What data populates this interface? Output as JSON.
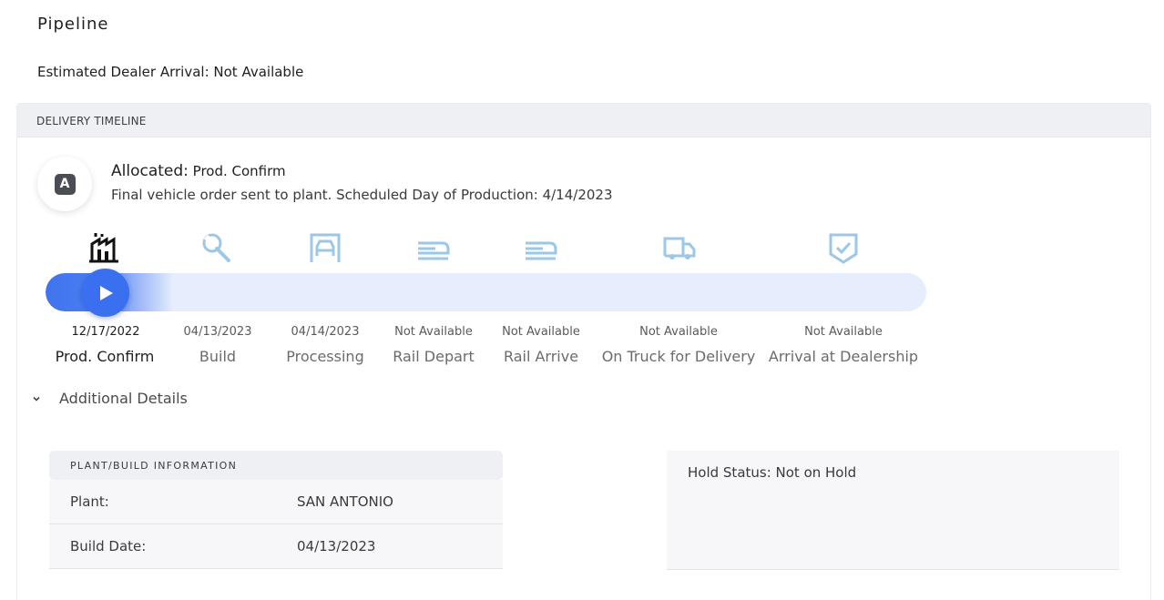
{
  "page": {
    "title": "Pipeline",
    "eta_label": "Estimated Dealer Arrival: Not Available"
  },
  "timeline": {
    "header": "DELIVERY TIMELINE",
    "status_badge": "A",
    "status_label": "Allocated:",
    "status_stage": "Prod. Confirm",
    "status_description": "Final vehicle order sent to plant. Scheduled Day of Production: 4/14/2023",
    "progress_fraction": 0.07,
    "stages": [
      {
        "name": "Prod. Confirm",
        "date": "12/17/2022",
        "icon": "factory-icon",
        "active": true
      },
      {
        "name": "Build",
        "date": "04/13/2023",
        "icon": "wrench-icon",
        "active": false
      },
      {
        "name": "Processing",
        "date": "04/14/2023",
        "icon": "car-garage-icon",
        "active": false
      },
      {
        "name": "Rail Depart",
        "date": "Not Available",
        "icon": "train-icon",
        "active": false
      },
      {
        "name": "Rail Arrive",
        "date": "Not Available",
        "icon": "train-icon",
        "active": false
      },
      {
        "name": "On Truck for Delivery",
        "date": "Not Available",
        "icon": "truck-icon",
        "active": false
      },
      {
        "name": "Arrival at Dealership",
        "date": "Not Available",
        "icon": "shield-check-icon",
        "active": false
      }
    ]
  },
  "details": {
    "toggle_label": "Additional Details",
    "plant_header": "PLANT/BUILD INFORMATION",
    "rows": [
      {
        "label": "Plant:",
        "value": "SAN ANTONIO"
      },
      {
        "label": "Build Date:",
        "value": "04/13/2023"
      }
    ],
    "hold_status": "Hold Status: Not on Hold"
  },
  "colors": {
    "accent": "#3a6ff0",
    "track": "#e6edfd",
    "icon_inactive": "#9cc7e6",
    "header_bg": "#eff0f4"
  }
}
